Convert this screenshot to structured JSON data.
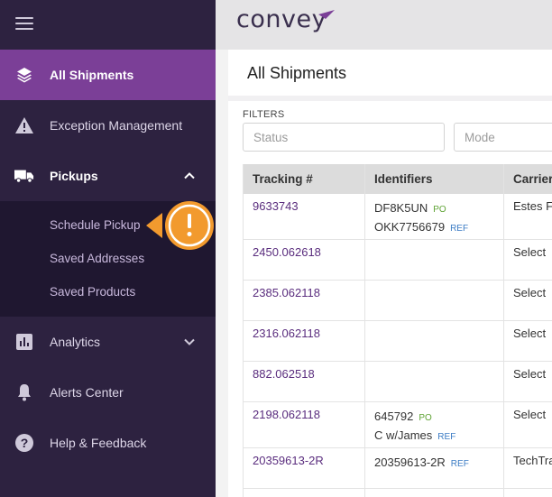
{
  "brand": {
    "name": "convey",
    "accent": "#7b3f97",
    "sidebar_bg": "#2d2240"
  },
  "sidebar": {
    "menu_icon": "hamburger-icon",
    "items": [
      {
        "label": "All Shipments",
        "icon": "layers-icon",
        "state": "active"
      },
      {
        "label": "Exception Management",
        "icon": "warning-icon"
      },
      {
        "label": "Pickups",
        "icon": "truck-icon",
        "state": "expanded",
        "chevron": "chevron-up-icon"
      },
      {
        "label": "Analytics",
        "icon": "bar-chart-icon",
        "chevron": "chevron-down-icon"
      },
      {
        "label": "Alerts Center",
        "icon": "bell-icon"
      },
      {
        "label": "Help & Feedback",
        "icon": "help-icon"
      }
    ],
    "pickups_sub": [
      "Schedule Pickup",
      "Saved Addresses",
      "Saved Products"
    ]
  },
  "callout": {
    "symbol": "!",
    "color": "#f29a2e"
  },
  "main": {
    "title": "All Shipments",
    "filters_label": "FILTERS",
    "filters": [
      {
        "placeholder": "Status"
      },
      {
        "placeholder": "Mode"
      }
    ]
  },
  "table": {
    "columns": [
      "Tracking #",
      "Identifiers",
      "Carrier"
    ],
    "rows": [
      {
        "tracking": "9633743",
        "ids": [
          {
            "value": "DF8K5UN",
            "tag": "PO"
          },
          {
            "value": "OKK7756679",
            "tag": "REF"
          }
        ],
        "carrier": "Estes F"
      },
      {
        "tracking": "2450.062618",
        "ids": [],
        "carrier": "Select"
      },
      {
        "tracking": "2385.062118",
        "ids": [],
        "carrier": "Select"
      },
      {
        "tracking": "2316.062118",
        "ids": [],
        "carrier": "Select"
      },
      {
        "tracking": "882.062518",
        "ids": [],
        "carrier": "Select"
      },
      {
        "tracking": "2198.062118",
        "ids": [
          {
            "value": "645792",
            "tag": "PO"
          },
          {
            "value": "C w/James",
            "tag": "REF"
          }
        ],
        "carrier": "Select"
      },
      {
        "tracking": "20359613-2R",
        "ids": [
          {
            "value": "20359613-2R",
            "tag": "REF"
          }
        ],
        "carrier": "TechTra"
      }
    ]
  }
}
